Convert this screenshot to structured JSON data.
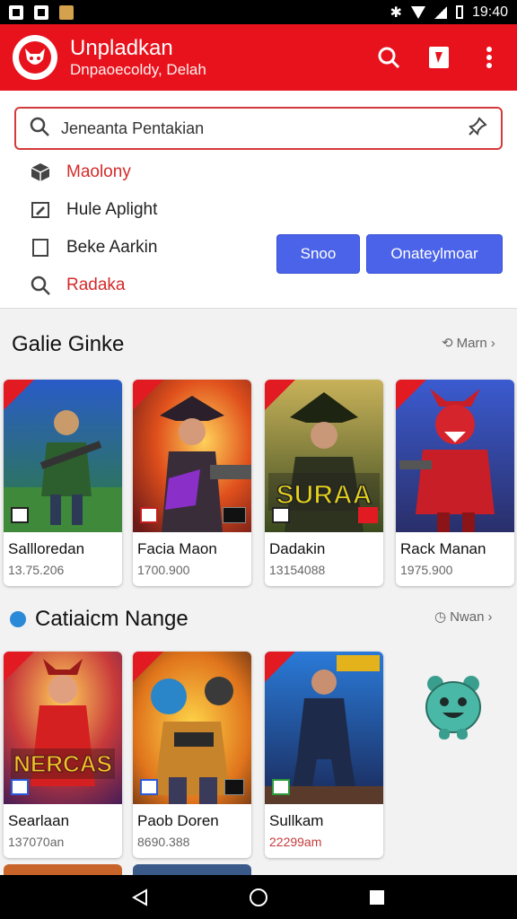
{
  "status_bar": {
    "time": "19:40"
  },
  "app_bar": {
    "title": "Unpladkan",
    "subtitle": "Dnpaoecoldy, Delah",
    "search_icon": "search-icon",
    "clipboard_icon": "clipboard-icon",
    "more_icon": "more-vert-icon"
  },
  "search": {
    "placeholder": "Jeneanta Pentakian"
  },
  "menu": [
    {
      "label": "Maolony",
      "icon": "package-icon",
      "color": "#d42a2a"
    },
    {
      "label": "Hule Aplight",
      "icon": "edit-tag-icon",
      "color": "#222222"
    },
    {
      "label": "Beke Aarkin",
      "icon": "square-icon",
      "color": "#222222"
    },
    {
      "label": "Radaka",
      "icon": "search-icon",
      "color": "#d42a2a"
    }
  ],
  "buttons": {
    "primary": "Snoo",
    "secondary": "Onateylmoar"
  },
  "sections": [
    {
      "title": "Galie Ginke",
      "more": "Marn",
      "cards": [
        {
          "title": "Sallloredan",
          "count": "13.75.206"
        },
        {
          "title": "Facia Maon",
          "count": "1700.900"
        },
        {
          "title": "Dadakin",
          "count": "13154088",
          "art_text": "SURAA"
        },
        {
          "title": "Rack Manan",
          "count": "1975.900"
        }
      ]
    },
    {
      "title": "Catiaicm Nange",
      "more": "Nwan",
      "cards": [
        {
          "title": "Searlaan",
          "count": "137070an",
          "art_text": "NERCAS"
        },
        {
          "title": "Paob Doren",
          "count": "8690.388"
        },
        {
          "title": "Sullkam",
          "count": "22299am",
          "count_color": "#c43b3b"
        }
      ]
    }
  ],
  "colors": {
    "brand_red": "#e8121c",
    "button_blue": "#4b63e8"
  }
}
